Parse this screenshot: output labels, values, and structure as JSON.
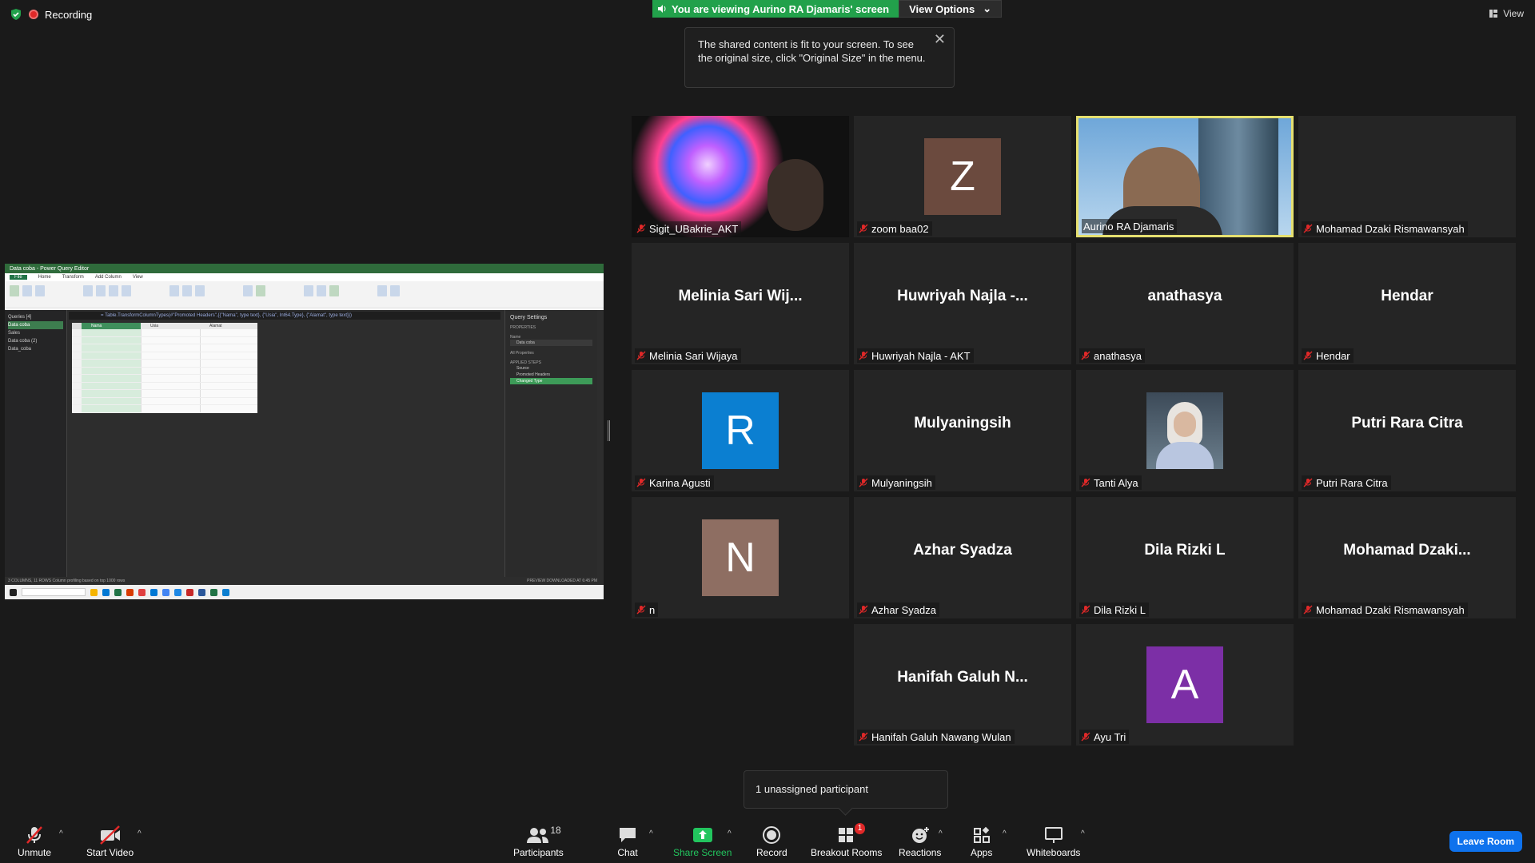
{
  "top": {
    "recording_label": "Recording",
    "banner_text": "You are viewing Aurino RA Djamaris' screen",
    "view_options_label": "View Options",
    "tooltip_text": "The shared content is fit to your screen. To see the original size, click \"Original Size\" in the menu.",
    "view_label": "View"
  },
  "shared_screen": {
    "window_title": "Data coba - Power Query Editor",
    "tabs": [
      "File",
      "Home",
      "Transform",
      "Add Column",
      "View"
    ],
    "queries_header": "Queries [4]",
    "queries": [
      "Data coba",
      "Sales",
      "Data coba (2)",
      "Data_coba"
    ],
    "formula": "= Table.TransformColumnTypes(#\"Promoted Headers\",{{\"Nama\", type text}, {\"Usia\", Int64.Type}, {\"Alamat\", type text}})",
    "columns": [
      "Nama",
      "Usia",
      "Alamat"
    ],
    "query_settings_title": "Query Settings",
    "properties_label": "PROPERTIES",
    "name_label": "Name",
    "name_value": "Data coba",
    "all_properties": "All Properties",
    "applied_steps_label": "APPLIED STEPS",
    "steps": [
      "Source",
      "Promoted Headers",
      "Changed Type"
    ],
    "status_left": "3 COLUMNS, 11 ROWS   Column profiling based on top 1000 rows",
    "status_right": "PREVIEW DOWNLOADED AT 6:45 PM"
  },
  "participants": [
    {
      "name": "Sigit_UBakrie_AKT",
      "display": "",
      "type": "video-burst"
    },
    {
      "name": "zoom baa02",
      "display": "Z",
      "type": "avatar",
      "color": "#6b4a3e"
    },
    {
      "name": "Aurino RA Djamaris",
      "display": "",
      "type": "video-building"
    },
    {
      "name": "Mohamad Dzaki Rismawansyah",
      "display": "",
      "type": "blank"
    },
    {
      "name": "Melinia Sari Wijaya",
      "display": "Melinia Sari Wij...",
      "type": "text"
    },
    {
      "name": "Huwriyah Najla - AKT",
      "display": "Huwriyah Najla -...",
      "type": "text"
    },
    {
      "name": "anathasya",
      "display": "anathasya",
      "type": "text"
    },
    {
      "name": "Hendar",
      "display": "Hendar",
      "type": "text"
    },
    {
      "name": "Karina Agusti",
      "display": "R",
      "type": "avatar",
      "color": "#0b7fd1"
    },
    {
      "name": "Mulyaningsih",
      "display": "Mulyaningsih",
      "type": "text"
    },
    {
      "name": "Tanti Alya",
      "display": "",
      "type": "photo"
    },
    {
      "name": "Putri Rara Citra",
      "display": "Putri Rara Citra",
      "type": "text"
    },
    {
      "name": "n",
      "display": "N",
      "type": "avatar",
      "color": "#8e6e62"
    },
    {
      "name": "Azhar Syadza",
      "display": "Azhar Syadza",
      "type": "text"
    },
    {
      "name": "Dila Rizki L",
      "display": "Dila Rizki L",
      "type": "text"
    },
    {
      "name": "Mohamad Dzaki Rismawansyah",
      "display": "Mohamad  Dzaki...",
      "type": "text"
    },
    {
      "name": "Hanifah Galuh Nawang Wulan",
      "display": "Hanifah Galuh N...",
      "type": "text"
    },
    {
      "name": "Ayu Tri",
      "display": "A",
      "type": "avatar",
      "color": "#7c2fa6"
    }
  ],
  "toast": {
    "text": "1 unassigned participant"
  },
  "toolbar": {
    "unmute": "Unmute",
    "start_video": "Start Video",
    "participants": "Participants",
    "participants_count": "18",
    "chat": "Chat",
    "share_screen": "Share Screen",
    "record": "Record",
    "breakout_rooms": "Breakout Rooms",
    "breakout_badge": "1",
    "reactions": "Reactions",
    "apps": "Apps",
    "whiteboards": "Whiteboards",
    "leave_room": "Leave Room"
  },
  "colors": {
    "accent_green": "#22a14b",
    "active_speaker": "#e6e070",
    "leave_blue": "#0e72ed",
    "muted_red": "#e02828"
  }
}
